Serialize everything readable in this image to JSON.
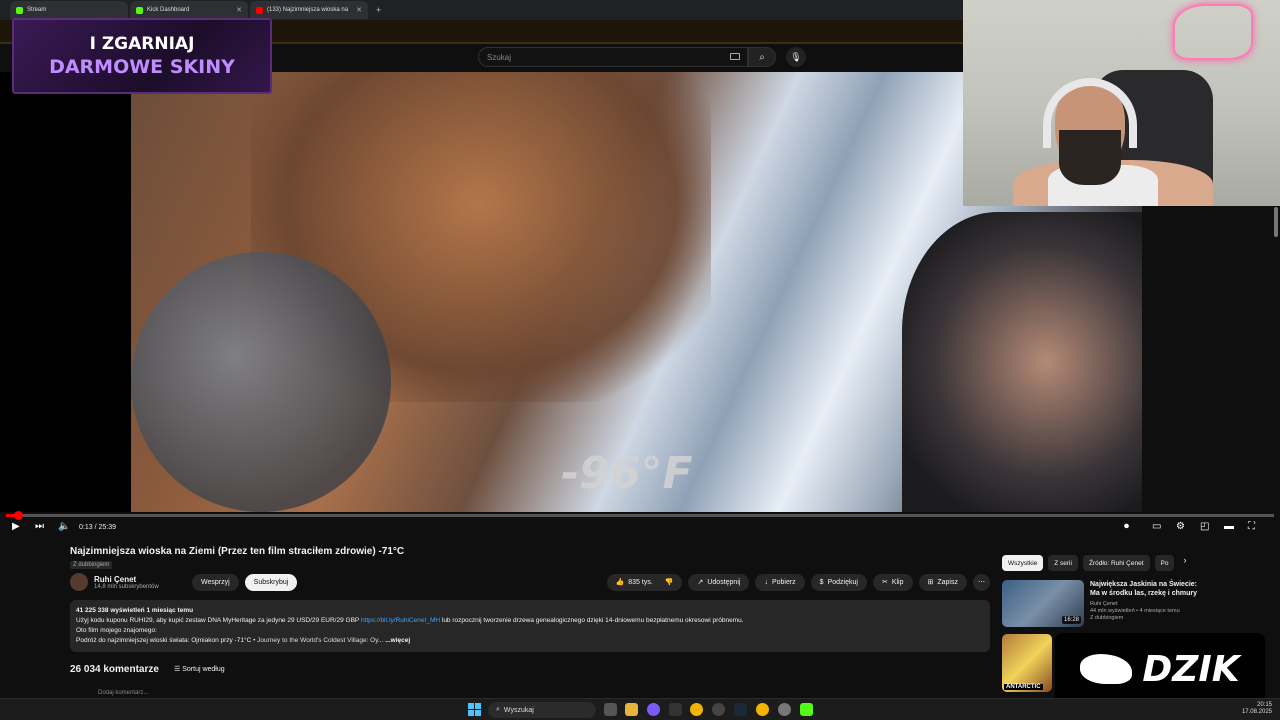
{
  "browser": {
    "tabs": [
      {
        "label": "Stream",
        "color": "#53fc18"
      },
      {
        "label": "Kick Dashboard",
        "color": "#53fc18"
      },
      {
        "label": "(133) Najzimniejsza wioska na",
        "color": "#ff0000"
      }
    ],
    "new_tab": "+"
  },
  "youtube": {
    "search_placeholder": "Szukaj"
  },
  "promo": {
    "line1": "I ZGARNIAJ",
    "line2": "DARMOWE SKINY"
  },
  "video": {
    "overlay_text": "-96°F",
    "time": "0:13 / 25:39",
    "progress": 0.008
  },
  "meta": {
    "title": "Najzimniejsza wioska na Ziemi (Przez ten film straciłem zdrowie) -71°C",
    "dubbing_badge": "Z dubbingiem",
    "channel_name": "Ruhi Çenet",
    "channel_subs": "14,8 mln subskrybentów",
    "support_label": "Wesprzyj",
    "subscribe_label": "Subskrybuj",
    "likes": "835 tys.",
    "share_label": "Udostępnij",
    "download_label": "Pobierz",
    "thanks_label": "Podziękuj",
    "clip_label": "Klip",
    "save_label": "Zapisz",
    "views_line": "41 225 338 wyświetleń  1 miesiąc temu",
    "desc_line1_a": "Użyj kodu kuponu RUHI29, aby kupić zestaw DNA MyHeritage za jedyne 29 USD/29 EUR/29 GBP ",
    "desc_link": "https://bit.ly/RuhiCenet_MH",
    "desc_line1_b": " lub rozpocznij tworzenie drzewa genealogicznego dzięki 14-dniowemu bezpłatnemu okresowi próbnemu.",
    "desc_line2": "Oto film mojego znajomego:",
    "desc_line3": "Podróż do najzimniejszej wioski świata: Ojmiakon przy -71°C",
    "desc_line3_b": "• Journey to the World's Coldest Village: Oy...",
    "more_label": "...więcej",
    "comments_count": "26 034 komentarze",
    "sort_label": "Sortuj według",
    "add_comment": "Dodaj komentarz..."
  },
  "sidebar": {
    "chips": [
      "Wszystkie",
      "Z serii",
      "Źródło: Ruhi Çenet",
      "Po"
    ],
    "rec1": {
      "title": "Największa Jaskinia na Świecie: Ma w środku las, rzekę i chmury",
      "channel": "Ruhi Çenet",
      "stats": "44 mln wyświetleń • 4 miesiące temu",
      "badge": "Z dubbingiem",
      "duration": "16:28"
    },
    "rec2_label": "ANTARCTIC"
  },
  "overlay": {
    "brand": "DZIK"
  },
  "taskbar": {
    "search": "Wyszukaj",
    "time": "20:15",
    "date": "17.08.2025"
  }
}
